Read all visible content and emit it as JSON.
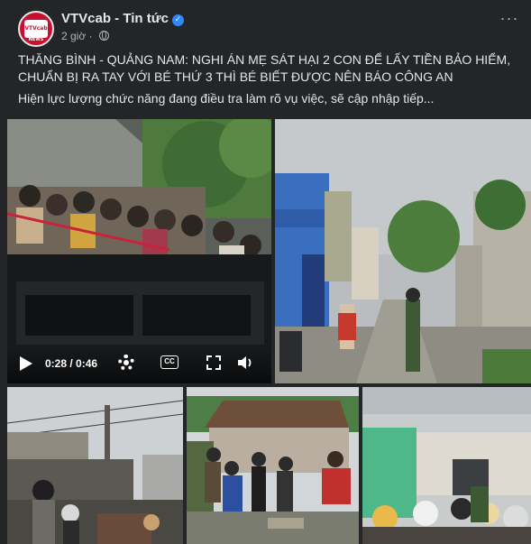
{
  "post": {
    "page_name": "VTVcab - Tin tức",
    "time_ago": "2 giờ",
    "avatar_text": "VTVcab",
    "avatar_sub": "NEWS",
    "title": "THĂNG BÌNH - QUẢNG NAM: NGHI ÁN MẸ SÁT HẠI 2 CON ĐỂ LẤY TIỀN BẢO HIỂM, CHUẨN BỊ RA TAY VỚI BÉ THỨ 3 THÌ BÉ BIẾT ĐƯỢC NÊN BÁO CÔNG AN",
    "subtitle": "Hiện lực lượng chức năng đang điều tra làm rõ vụ việc, sẽ cập nhập tiếp...",
    "more_icon": "ellipsis-icon",
    "verified_icon": "verified-check-icon"
  },
  "video": {
    "current_time": "0:28",
    "separator": " / ",
    "duration": "0:46",
    "cc_label": "CC"
  },
  "colors": {
    "background": "#242526",
    "text": "#e4e6eb",
    "secondary_text": "#b0b3b8",
    "verified": "#2d88ff",
    "brand": "#c8102e"
  }
}
